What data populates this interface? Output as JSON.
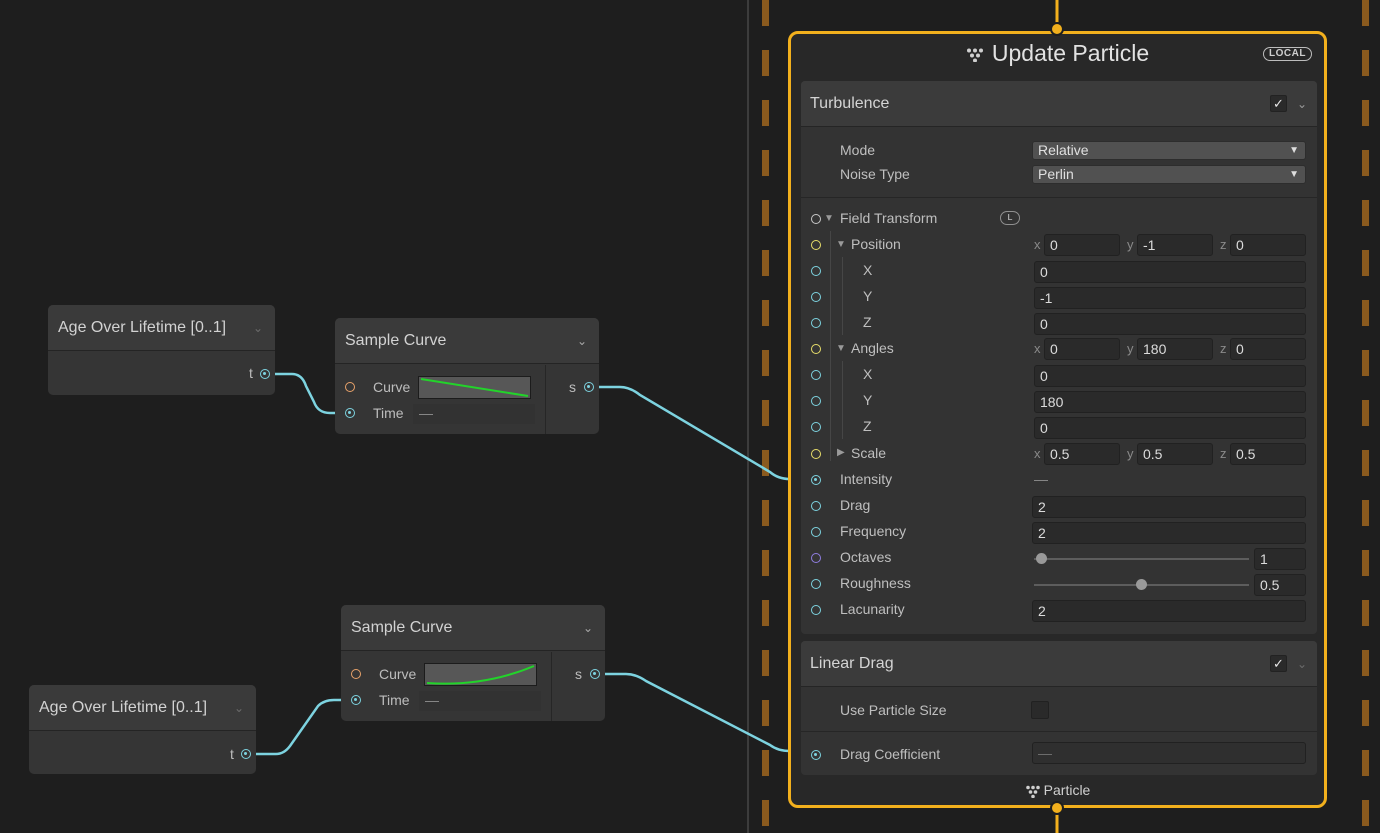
{
  "left_nodes": {
    "age_top": {
      "title": "Age Over Lifetime [0..1]",
      "out_port": "t"
    },
    "sample_top": {
      "title": "Sample Curve",
      "curve_label": "Curve",
      "time_label": "Time",
      "time_value": "—",
      "out_port": "s"
    },
    "sample_bottom": {
      "title": "Sample Curve",
      "curve_label": "Curve",
      "time_label": "Time",
      "time_value": "—",
      "out_port": "s"
    },
    "age_bottom": {
      "title": "Age Over Lifetime [0..1]",
      "out_port": "t"
    }
  },
  "context": {
    "title": "Update Particle",
    "space_badge": "LOCAL",
    "footer_label": "Particle",
    "turbulence": {
      "title": "Turbulence",
      "check": "✓",
      "mode_label": "Mode",
      "mode_value": "Relative",
      "noise_label": "Noise Type",
      "noise_value": "Perlin",
      "field_transform": "Field Transform",
      "field_badge": "L",
      "position": {
        "label": "Position",
        "x": "0",
        "y": "-1",
        "z": "0"
      },
      "pos_x": {
        "label": "X",
        "value": "0"
      },
      "pos_y": {
        "label": "Y",
        "value": "-1"
      },
      "pos_z": {
        "label": "Z",
        "value": "0"
      },
      "angles": {
        "label": "Angles",
        "x": "0",
        "y": "180",
        "z": "0"
      },
      "ang_x": {
        "label": "X",
        "value": "0"
      },
      "ang_y": {
        "label": "Y",
        "value": "180"
      },
      "ang_z": {
        "label": "Z",
        "value": "0"
      },
      "scale": {
        "label": "Scale",
        "x": "0.5",
        "y": "0.5",
        "z": "0.5"
      },
      "intensity": {
        "label": "Intensity",
        "value": "—"
      },
      "drag": {
        "label": "Drag",
        "value": "2"
      },
      "frequency": {
        "label": "Frequency",
        "value": "2"
      },
      "octaves": {
        "label": "Octaves",
        "value": "1",
        "level": 0
      },
      "roughness": {
        "label": "Roughness",
        "value": "0.5",
        "level": 0.5
      },
      "lacunarity": {
        "label": "Lacunarity",
        "value": "2"
      }
    },
    "linear_drag": {
      "title": "Linear Drag",
      "check": "✓",
      "use_size_label": "Use Particle Size",
      "coef_label": "Drag Coefficient",
      "coef_value": "—"
    }
  },
  "axis_labels": {
    "x": "x",
    "y": "y",
    "z": "z"
  },
  "colors": {
    "accent": "#f2b01d",
    "wire": "#7dd3e0",
    "curve": "#22d42a"
  }
}
